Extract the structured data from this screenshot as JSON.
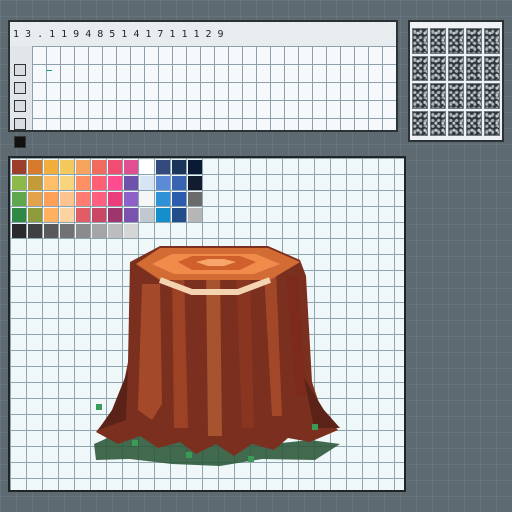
{
  "timeline": {
    "ruler_labels": [
      "1",
      "3",
      ".",
      "1",
      "1",
      "9",
      "4",
      "8",
      "5",
      "1",
      "4",
      "1",
      "7",
      "1",
      "1",
      "1",
      "2",
      "9"
    ]
  },
  "toolbar": {
    "tools": [
      "select-tool",
      "frame-tool",
      "layer-tool",
      "onion-tool",
      "fill-tool"
    ]
  },
  "palette": {
    "rows": [
      [
        "#9b3f2c",
        "#d67b2e",
        "#f1ae3d",
        "#f3c85d",
        "#f6a45d",
        "#f06b5d",
        "#f04d73",
        "#e04f8f",
        "#ffffff",
        "#354a7c",
        "#19355a",
        "#0b1a34"
      ],
      [
        "#8db94a",
        "#c39c3a",
        "#ffbf69",
        "#f8d47e",
        "#ff8f64",
        "#ff5f73",
        "#ff4c8f",
        "#6f52a9",
        "#d6e4f3",
        "#5b8ad8",
        "#3863b0",
        "#111d2f"
      ],
      [
        "#5fa64c",
        "#e3a34d",
        "#ff9f58",
        "#ffc48d",
        "#ff7c73",
        "#ff5e7f",
        "#ea3d79",
        "#8d61c8",
        "#f6f6f6",
        "#2f92d7",
        "#2d5bad",
        "#6b6b6b"
      ],
      [
        "#2f8844",
        "#8f9b3b",
        "#ffb15f",
        "#ffd2a1",
        "#e15d66",
        "#ca4864",
        "#9e356d",
        "#7b53af",
        "#c2c8cf",
        "#158fcc",
        "#214d8a",
        "#b6b6b6"
      ]
    ],
    "greys": [
      "#2a2a2a",
      "#404040",
      "#595959",
      "#727272",
      "#8b8b8b",
      "#a5a5a5",
      "#bdbdbd",
      "#d6d6d6"
    ]
  },
  "canvas": {
    "subject": "tree stump sprite"
  }
}
